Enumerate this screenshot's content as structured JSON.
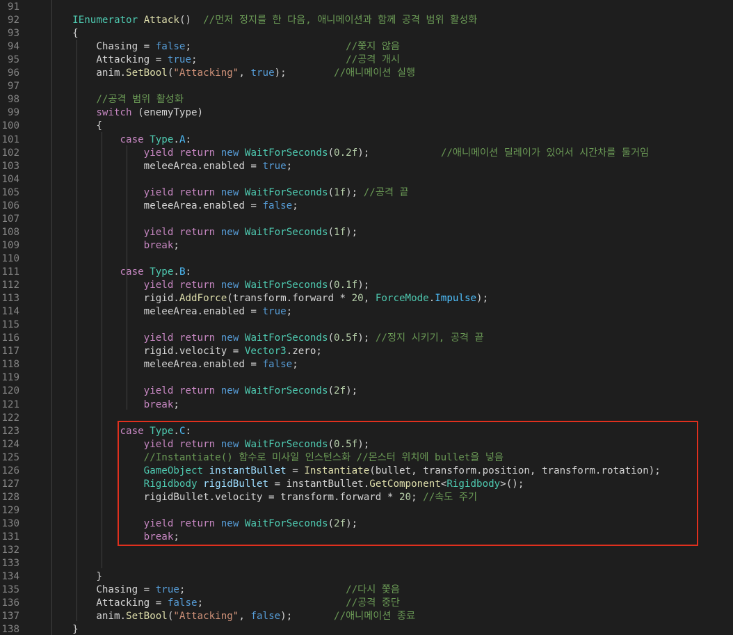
{
  "editor": {
    "theme_colors": {
      "background": "#1e1e1e",
      "highlight_border": "#e0301e"
    },
    "lines": [
      {
        "num": "91",
        "tokens": []
      },
      {
        "num": "92",
        "tokens": [
          [
            "p",
            "    "
          ],
          [
            "t",
            "IEnumerator"
          ],
          [
            "p",
            " "
          ],
          [
            "f",
            "Attack"
          ],
          [
            "p",
            "()  "
          ],
          [
            "c",
            "//먼저 정지를 한 다음, 애니메이션과 함께 공격 범위 활성화"
          ]
        ]
      },
      {
        "num": "93",
        "tokens": [
          [
            "p",
            "    {"
          ]
        ]
      },
      {
        "num": "94",
        "tokens": [
          [
            "p",
            "        Chasing = "
          ],
          [
            "kb",
            "false"
          ],
          [
            "p",
            ";                          "
          ],
          [
            "c",
            "//쫓지 않음"
          ]
        ]
      },
      {
        "num": "95",
        "tokens": [
          [
            "p",
            "        Attacking = "
          ],
          [
            "kb",
            "true"
          ],
          [
            "p",
            ";                         "
          ],
          [
            "c",
            "//공격 개시"
          ]
        ]
      },
      {
        "num": "96",
        "tokens": [
          [
            "p",
            "        anim."
          ],
          [
            "f",
            "SetBool"
          ],
          [
            "p",
            "("
          ],
          [
            "s",
            "\"Attacking\""
          ],
          [
            "p",
            ", "
          ],
          [
            "kb",
            "true"
          ],
          [
            "p",
            ");        "
          ],
          [
            "c",
            "//애니메이션 실행"
          ]
        ]
      },
      {
        "num": "97",
        "tokens": []
      },
      {
        "num": "98",
        "tokens": [
          [
            "p",
            "        "
          ],
          [
            "c",
            "//공격 범위 활성화"
          ]
        ]
      },
      {
        "num": "99",
        "tokens": [
          [
            "p",
            "        "
          ],
          [
            "k",
            "switch"
          ],
          [
            "p",
            " (enemyType)"
          ]
        ]
      },
      {
        "num": "100",
        "tokens": [
          [
            "p",
            "        {"
          ]
        ]
      },
      {
        "num": "101",
        "tokens": [
          [
            "p",
            "            "
          ],
          [
            "k",
            "case"
          ],
          [
            "p",
            " "
          ],
          [
            "t",
            "Type"
          ],
          [
            "p",
            "."
          ],
          [
            "e",
            "A"
          ],
          [
            "p",
            ":"
          ]
        ]
      },
      {
        "num": "102",
        "tokens": [
          [
            "p",
            "                "
          ],
          [
            "k",
            "yield"
          ],
          [
            "p",
            " "
          ],
          [
            "k",
            "return"
          ],
          [
            "p",
            " "
          ],
          [
            "kb",
            "new"
          ],
          [
            "p",
            " "
          ],
          [
            "t",
            "WaitForSeconds"
          ],
          [
            "p",
            "("
          ],
          [
            "n",
            "0.2f"
          ],
          [
            "p",
            ");            "
          ],
          [
            "c",
            "//애니메이션 딜레이가 있어서 시간차를 둘거임"
          ]
        ]
      },
      {
        "num": "103",
        "tokens": [
          [
            "p",
            "                meleeArea.enabled = "
          ],
          [
            "kb",
            "true"
          ],
          [
            "p",
            ";"
          ]
        ]
      },
      {
        "num": "104",
        "tokens": []
      },
      {
        "num": "105",
        "tokens": [
          [
            "p",
            "                "
          ],
          [
            "k",
            "yield"
          ],
          [
            "p",
            " "
          ],
          [
            "k",
            "return"
          ],
          [
            "p",
            " "
          ],
          [
            "kb",
            "new"
          ],
          [
            "p",
            " "
          ],
          [
            "t",
            "WaitForSeconds"
          ],
          [
            "p",
            "("
          ],
          [
            "n",
            "1f"
          ],
          [
            "p",
            "); "
          ],
          [
            "c",
            "//공격 끝"
          ]
        ]
      },
      {
        "num": "106",
        "tokens": [
          [
            "p",
            "                meleeArea.enabled = "
          ],
          [
            "kb",
            "false"
          ],
          [
            "p",
            ";"
          ]
        ]
      },
      {
        "num": "107",
        "tokens": []
      },
      {
        "num": "108",
        "tokens": [
          [
            "p",
            "                "
          ],
          [
            "k",
            "yield"
          ],
          [
            "p",
            " "
          ],
          [
            "k",
            "return"
          ],
          [
            "p",
            " "
          ],
          [
            "kb",
            "new"
          ],
          [
            "p",
            " "
          ],
          [
            "t",
            "WaitForSeconds"
          ],
          [
            "p",
            "("
          ],
          [
            "n",
            "1f"
          ],
          [
            "p",
            ");"
          ]
        ]
      },
      {
        "num": "109",
        "tokens": [
          [
            "p",
            "                "
          ],
          [
            "k",
            "break"
          ],
          [
            "p",
            ";"
          ]
        ]
      },
      {
        "num": "110",
        "tokens": []
      },
      {
        "num": "111",
        "tokens": [
          [
            "p",
            "            "
          ],
          [
            "k",
            "case"
          ],
          [
            "p",
            " "
          ],
          [
            "t",
            "Type"
          ],
          [
            "p",
            "."
          ],
          [
            "e",
            "B"
          ],
          [
            "p",
            ":"
          ]
        ]
      },
      {
        "num": "112",
        "tokens": [
          [
            "p",
            "                "
          ],
          [
            "k",
            "yield"
          ],
          [
            "p",
            " "
          ],
          [
            "k",
            "return"
          ],
          [
            "p",
            " "
          ],
          [
            "kb",
            "new"
          ],
          [
            "p",
            " "
          ],
          [
            "t",
            "WaitForSeconds"
          ],
          [
            "p",
            "("
          ],
          [
            "n",
            "0.1f"
          ],
          [
            "p",
            ");"
          ]
        ]
      },
      {
        "num": "113",
        "tokens": [
          [
            "p",
            "                rigid."
          ],
          [
            "f",
            "AddForce"
          ],
          [
            "p",
            "(transform.forward * "
          ],
          [
            "n",
            "20"
          ],
          [
            "p",
            ", "
          ],
          [
            "t",
            "ForceMode"
          ],
          [
            "p",
            "."
          ],
          [
            "e",
            "Impulse"
          ],
          [
            "p",
            ");"
          ]
        ]
      },
      {
        "num": "114",
        "tokens": [
          [
            "p",
            "                meleeArea.enabled = "
          ],
          [
            "kb",
            "true"
          ],
          [
            "p",
            ";"
          ]
        ]
      },
      {
        "num": "115",
        "tokens": []
      },
      {
        "num": "116",
        "tokens": [
          [
            "p",
            "                "
          ],
          [
            "k",
            "yield"
          ],
          [
            "p",
            " "
          ],
          [
            "k",
            "return"
          ],
          [
            "p",
            " "
          ],
          [
            "kb",
            "new"
          ],
          [
            "p",
            " "
          ],
          [
            "t",
            "WaitForSeconds"
          ],
          [
            "p",
            "("
          ],
          [
            "n",
            "0.5f"
          ],
          [
            "p",
            "); "
          ],
          [
            "c",
            "//정지 시키기, 공격 끝"
          ]
        ]
      },
      {
        "num": "117",
        "tokens": [
          [
            "p",
            "                rigid.velocity = "
          ],
          [
            "t",
            "Vector3"
          ],
          [
            "p",
            ".zero;"
          ]
        ]
      },
      {
        "num": "118",
        "tokens": [
          [
            "p",
            "                meleeArea.enabled = "
          ],
          [
            "kb",
            "false"
          ],
          [
            "p",
            ";"
          ]
        ]
      },
      {
        "num": "119",
        "tokens": []
      },
      {
        "num": "120",
        "tokens": [
          [
            "p",
            "                "
          ],
          [
            "k",
            "yield"
          ],
          [
            "p",
            " "
          ],
          [
            "k",
            "return"
          ],
          [
            "p",
            " "
          ],
          [
            "kb",
            "new"
          ],
          [
            "p",
            " "
          ],
          [
            "t",
            "WaitForSeconds"
          ],
          [
            "p",
            "("
          ],
          [
            "n",
            "2f"
          ],
          [
            "p",
            ");"
          ]
        ]
      },
      {
        "num": "121",
        "tokens": [
          [
            "p",
            "                "
          ],
          [
            "k",
            "break"
          ],
          [
            "p",
            ";"
          ]
        ]
      },
      {
        "num": "122",
        "tokens": []
      },
      {
        "num": "123",
        "tokens": [
          [
            "p",
            "            "
          ],
          [
            "k",
            "case"
          ],
          [
            "p",
            " "
          ],
          [
            "t",
            "Type"
          ],
          [
            "p",
            "."
          ],
          [
            "e",
            "C"
          ],
          [
            "p",
            ":"
          ]
        ]
      },
      {
        "num": "124",
        "tokens": [
          [
            "p",
            "                "
          ],
          [
            "k",
            "yield"
          ],
          [
            "p",
            " "
          ],
          [
            "k",
            "return"
          ],
          [
            "p",
            " "
          ],
          [
            "kb",
            "new"
          ],
          [
            "p",
            " "
          ],
          [
            "t",
            "WaitForSeconds"
          ],
          [
            "p",
            "("
          ],
          [
            "n",
            "0.5f"
          ],
          [
            "p",
            ");"
          ]
        ]
      },
      {
        "num": "125",
        "tokens": [
          [
            "p",
            "                "
          ],
          [
            "c",
            "//Instantiate() 함수로 미사일 인스턴스화 //몬스터 위치에 bullet을 넣음"
          ]
        ]
      },
      {
        "num": "126",
        "tokens": [
          [
            "p",
            "                "
          ],
          [
            "t",
            "GameObject"
          ],
          [
            "p",
            " "
          ],
          [
            "v",
            "instantBullet"
          ],
          [
            "p",
            " = "
          ],
          [
            "f",
            "Instantiate"
          ],
          [
            "p",
            "(bullet, transform.position, transform.rotation);"
          ]
        ]
      },
      {
        "num": "127",
        "tokens": [
          [
            "p",
            "                "
          ],
          [
            "t",
            "Rigidbody"
          ],
          [
            "p",
            " "
          ],
          [
            "v",
            "rigidBullet"
          ],
          [
            "p",
            " = instantBullet."
          ],
          [
            "f",
            "GetComponent"
          ],
          [
            "p",
            "<"
          ],
          [
            "t",
            "Rigidbody"
          ],
          [
            "p",
            ">();"
          ]
        ]
      },
      {
        "num": "128",
        "tokens": [
          [
            "p",
            "                rigidBullet.velocity = transform.forward * "
          ],
          [
            "n",
            "20"
          ],
          [
            "p",
            "; "
          ],
          [
            "c",
            "//속도 주기"
          ]
        ]
      },
      {
        "num": "129",
        "tokens": []
      },
      {
        "num": "130",
        "tokens": [
          [
            "p",
            "                "
          ],
          [
            "k",
            "yield"
          ],
          [
            "p",
            " "
          ],
          [
            "k",
            "return"
          ],
          [
            "p",
            " "
          ],
          [
            "kb",
            "new"
          ],
          [
            "p",
            " "
          ],
          [
            "t",
            "WaitForSeconds"
          ],
          [
            "p",
            "("
          ],
          [
            "n",
            "2f"
          ],
          [
            "p",
            ");"
          ]
        ]
      },
      {
        "num": "131",
        "tokens": [
          [
            "p",
            "                "
          ],
          [
            "k",
            "break"
          ],
          [
            "p",
            ";"
          ]
        ]
      },
      {
        "num": "132",
        "tokens": []
      },
      {
        "num": "133",
        "tokens": []
      },
      {
        "num": "134",
        "tokens": [
          [
            "p",
            "        }"
          ]
        ]
      },
      {
        "num": "135",
        "tokens": [
          [
            "p",
            "        Chasing = "
          ],
          [
            "kb",
            "true"
          ],
          [
            "p",
            ";                           "
          ],
          [
            "c",
            "//다시 쫓음"
          ]
        ]
      },
      {
        "num": "136",
        "tokens": [
          [
            "p",
            "        Attacking = "
          ],
          [
            "kb",
            "false"
          ],
          [
            "p",
            ";                        "
          ],
          [
            "c",
            "//공격 중단"
          ]
        ]
      },
      {
        "num": "137",
        "tokens": [
          [
            "p",
            "        anim."
          ],
          [
            "f",
            "SetBool"
          ],
          [
            "p",
            "("
          ],
          [
            "s",
            "\"Attacking\""
          ],
          [
            "p",
            ", "
          ],
          [
            "kb",
            "false"
          ],
          [
            "p",
            ");       "
          ],
          [
            "c",
            "//애니메이션 종료"
          ]
        ]
      },
      {
        "num": "138",
        "tokens": [
          [
            "p",
            "    }"
          ]
        ]
      }
    ]
  }
}
